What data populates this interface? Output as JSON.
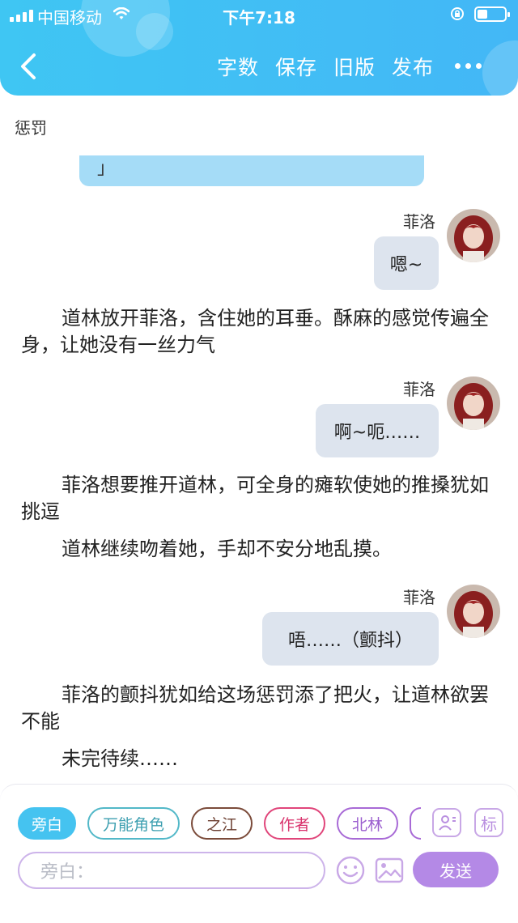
{
  "status_bar": {
    "carrier": "中国移动",
    "time": "下午7:18"
  },
  "header": {
    "actions": [
      "字数",
      "保存",
      "旧版",
      "发布"
    ]
  },
  "chapter_title": "惩罚",
  "clipped_bubble_text": "」",
  "messages": [
    {
      "speaker": "菲洛",
      "text": "嗯~"
    },
    {
      "narration": "道林放开菲洛，含住她的耳垂。酥麻的感觉传遍全身，让她没有一丝力气"
    },
    {
      "speaker": "菲洛",
      "text": "啊~呃……"
    },
    {
      "narration": "菲洛想要推开道林，可全身的瘫软使她的推搡犹如挑逗"
    },
    {
      "narration": "道林继续吻着她，手却不安分地乱摸。"
    },
    {
      "speaker": "菲洛",
      "text": "唔……（颤抖）"
    },
    {
      "narration": "菲洛的颤抖犹如给这场惩罚添了把火，让道林欲罢不能"
    },
    {
      "narration": "未完待续……"
    }
  ],
  "roles": [
    "旁白",
    "万能角色",
    "之江",
    "作者",
    "北林"
  ],
  "role_colors": [
    "#45c3f0",
    "#52b8c8",
    "#7b4b3a",
    "#e0457a",
    "#a86ad6"
  ],
  "tag_button": "标",
  "input": {
    "placeholder": "旁白："
  },
  "send_label": "发送",
  "icons": [
    "back-icon",
    "more-icon",
    "character-icon",
    "tag-icon",
    "emoji-icon",
    "image-icon",
    "signal-icon",
    "wifi-icon",
    "battery-icon"
  ]
}
